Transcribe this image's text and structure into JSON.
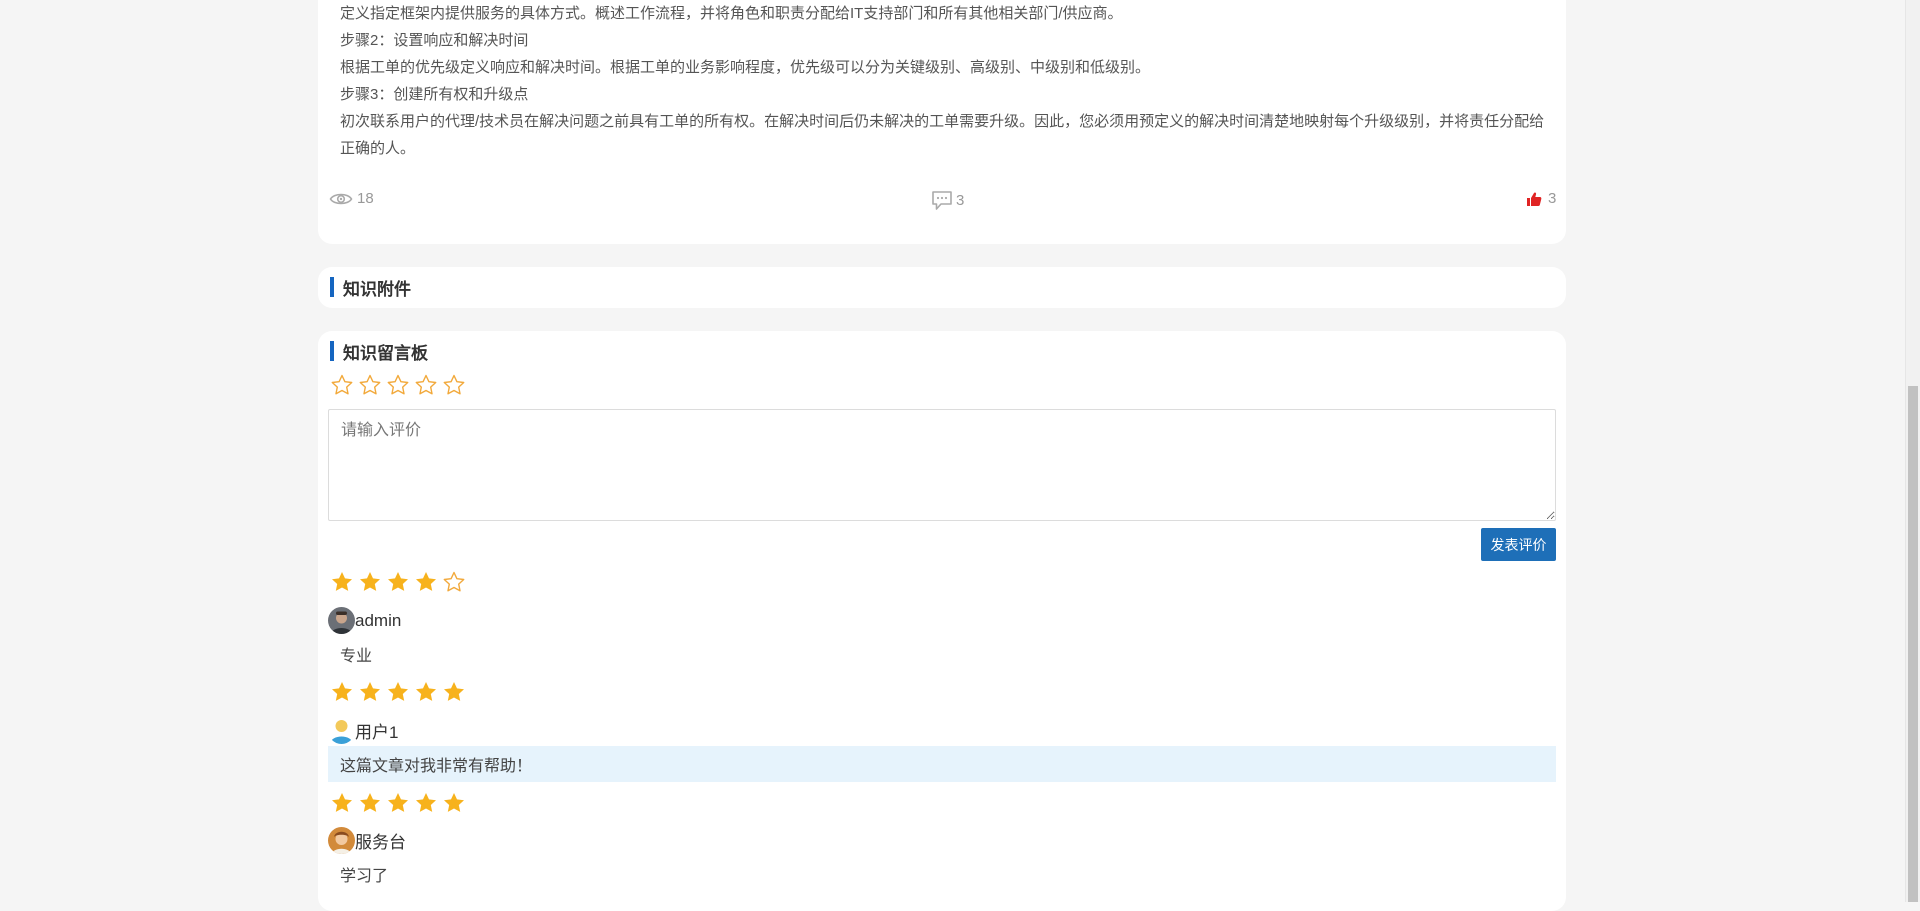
{
  "article": {
    "paragraphs": [
      "定义指定框架内提供服务的具体方式。概述工作流程，并将角色和职责分配给IT支持部门和所有其他相关部门/供应商。",
      "步骤2：设置响应和解决时间",
      "根据工单的优先级定义响应和解决时间。根据工单的业务影响程度，优先级可以分为关键级别、高级别、中级别和低级别。",
      "步骤3：创建所有权和升级点",
      "初次联系用户的代理/技术员在解决问题之前具有工单的所有权。在解决时间后仍未解决的工单需要升级。因此，您必须用预定义的解决时间清楚地映射每个升级级别，并将责任分配给正确的人。"
    ],
    "views": "18",
    "comments": "3",
    "likes": "3"
  },
  "attachments": {
    "title": "知识附件"
  },
  "message_board": {
    "title": "知识留言板",
    "rating_input": 0,
    "review_placeholder": "请输入评价",
    "review_value": "",
    "publish_label": "发表评价",
    "comments": [
      {
        "rating": 4,
        "user": "admin",
        "text": "专业",
        "avatar": "photo-avatar-man",
        "highlighted": false
      },
      {
        "rating": 5,
        "user": "用户1",
        "text": "这篇文章对我非常有帮助！",
        "avatar": "default-person-avatar",
        "highlighted": true
      },
      {
        "rating": 5,
        "user": "服务台",
        "text": "学习了",
        "avatar": "photo-avatar-woman",
        "highlighted": false
      }
    ]
  },
  "colors": {
    "accent": "#1565c0",
    "button": "#1e6fb8",
    "star_filled": "#f7b21c",
    "star_empty": "#f2a93b",
    "like": "#e02424",
    "highlight_bg": "#e6f3fc"
  }
}
